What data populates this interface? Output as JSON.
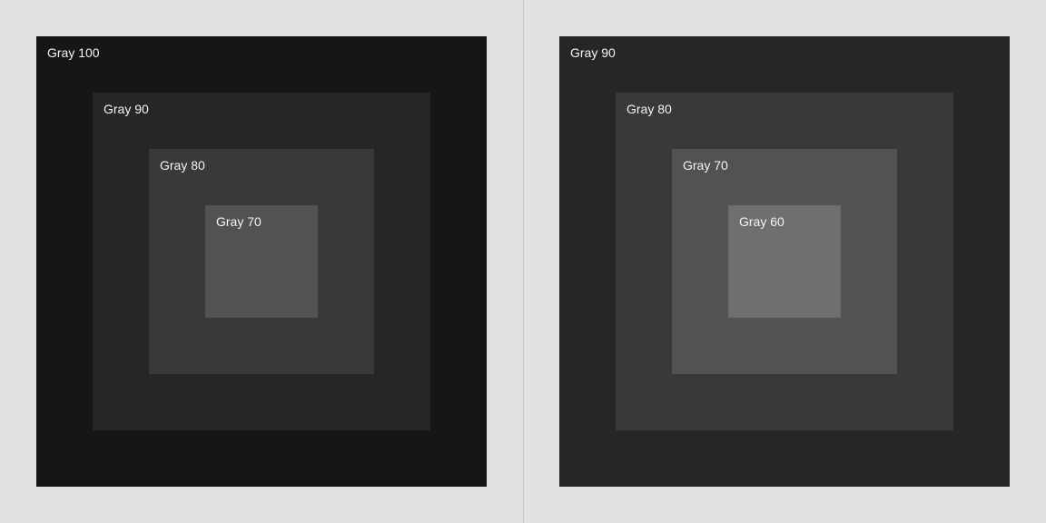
{
  "left": {
    "layers": [
      {
        "label": "Gray 100",
        "color": "#161616"
      },
      {
        "label": "Gray 90",
        "color": "#262626"
      },
      {
        "label": "Gray 80",
        "color": "#393939"
      },
      {
        "label": "Gray 70",
        "color": "#525252"
      }
    ]
  },
  "right": {
    "layers": [
      {
        "label": "Gray 90",
        "color": "#262626"
      },
      {
        "label": "Gray 80",
        "color": "#393939"
      },
      {
        "label": "Gray 70",
        "color": "#525252"
      },
      {
        "label": "Gray 60",
        "color": "#6f6f6f"
      }
    ]
  },
  "colors": {
    "gray100": "#161616",
    "gray90": "#262626",
    "gray80": "#393939",
    "gray70": "#525252",
    "gray60": "#6f6f6f",
    "page_bg": "#e2e2e2",
    "divider": "#c6c6c6"
  }
}
